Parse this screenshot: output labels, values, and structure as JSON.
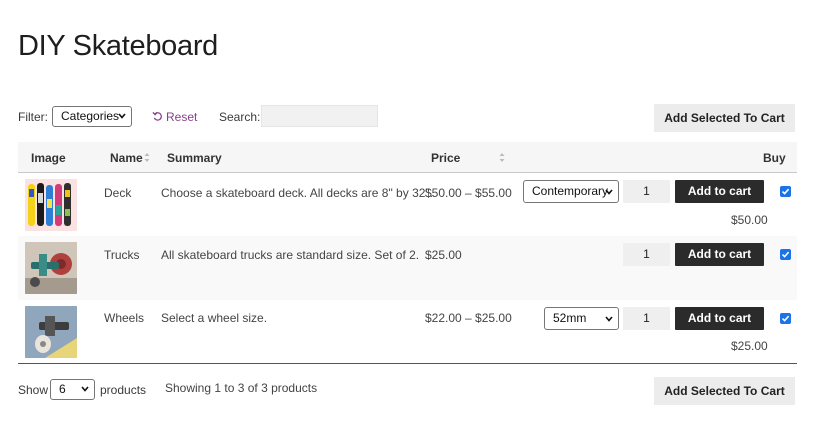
{
  "page": {
    "title": "DIY Skateboard"
  },
  "controls": {
    "filter_label": "Filter:",
    "filter_value": "Categories",
    "reset_label": "Reset",
    "search_label": "Search:",
    "search_value": "",
    "add_selected_label": "Add Selected To Cart"
  },
  "table": {
    "headers": {
      "image": "Image",
      "name": "Name",
      "summary": "Summary",
      "price": "Price",
      "buy": "Buy"
    },
    "rows": [
      {
        "image_icon": "skateboard-decks-image",
        "name": "Deck",
        "summary": "Choose a skateboard deck. All decks are 8\" by 32\".",
        "price": "$50.00 – $55.00",
        "variation": "Contemporary",
        "quantity": "1",
        "add_label": "Add to cart",
        "selected": true,
        "variation_price": "$50.00"
      },
      {
        "image_icon": "skateboard-truck-image",
        "name": "Trucks",
        "summary": "All skateboard trucks are standard size. Set of 2.",
        "price": "$25.00",
        "variation": "",
        "quantity": "1",
        "add_label": "Add to cart",
        "selected": true,
        "variation_price": ""
      },
      {
        "image_icon": "skateboard-wheels-image",
        "name": "Wheels",
        "summary": "Select a wheel size.",
        "price": "$22.00 – $25.00",
        "variation": "52mm",
        "quantity": "1",
        "add_label": "Add to cart",
        "selected": true,
        "variation_price": "$25.00"
      }
    ]
  },
  "footer": {
    "show_label": "Show",
    "show_value": "6",
    "products_label": "products",
    "showing_text": "Showing 1 to 3 of 3 products",
    "add_selected_label": "Add Selected To Cart"
  },
  "colors": {
    "accent_link": "#8a3f8a",
    "button_dark": "#2b2b2b",
    "checkbox": "#1a73e8"
  }
}
